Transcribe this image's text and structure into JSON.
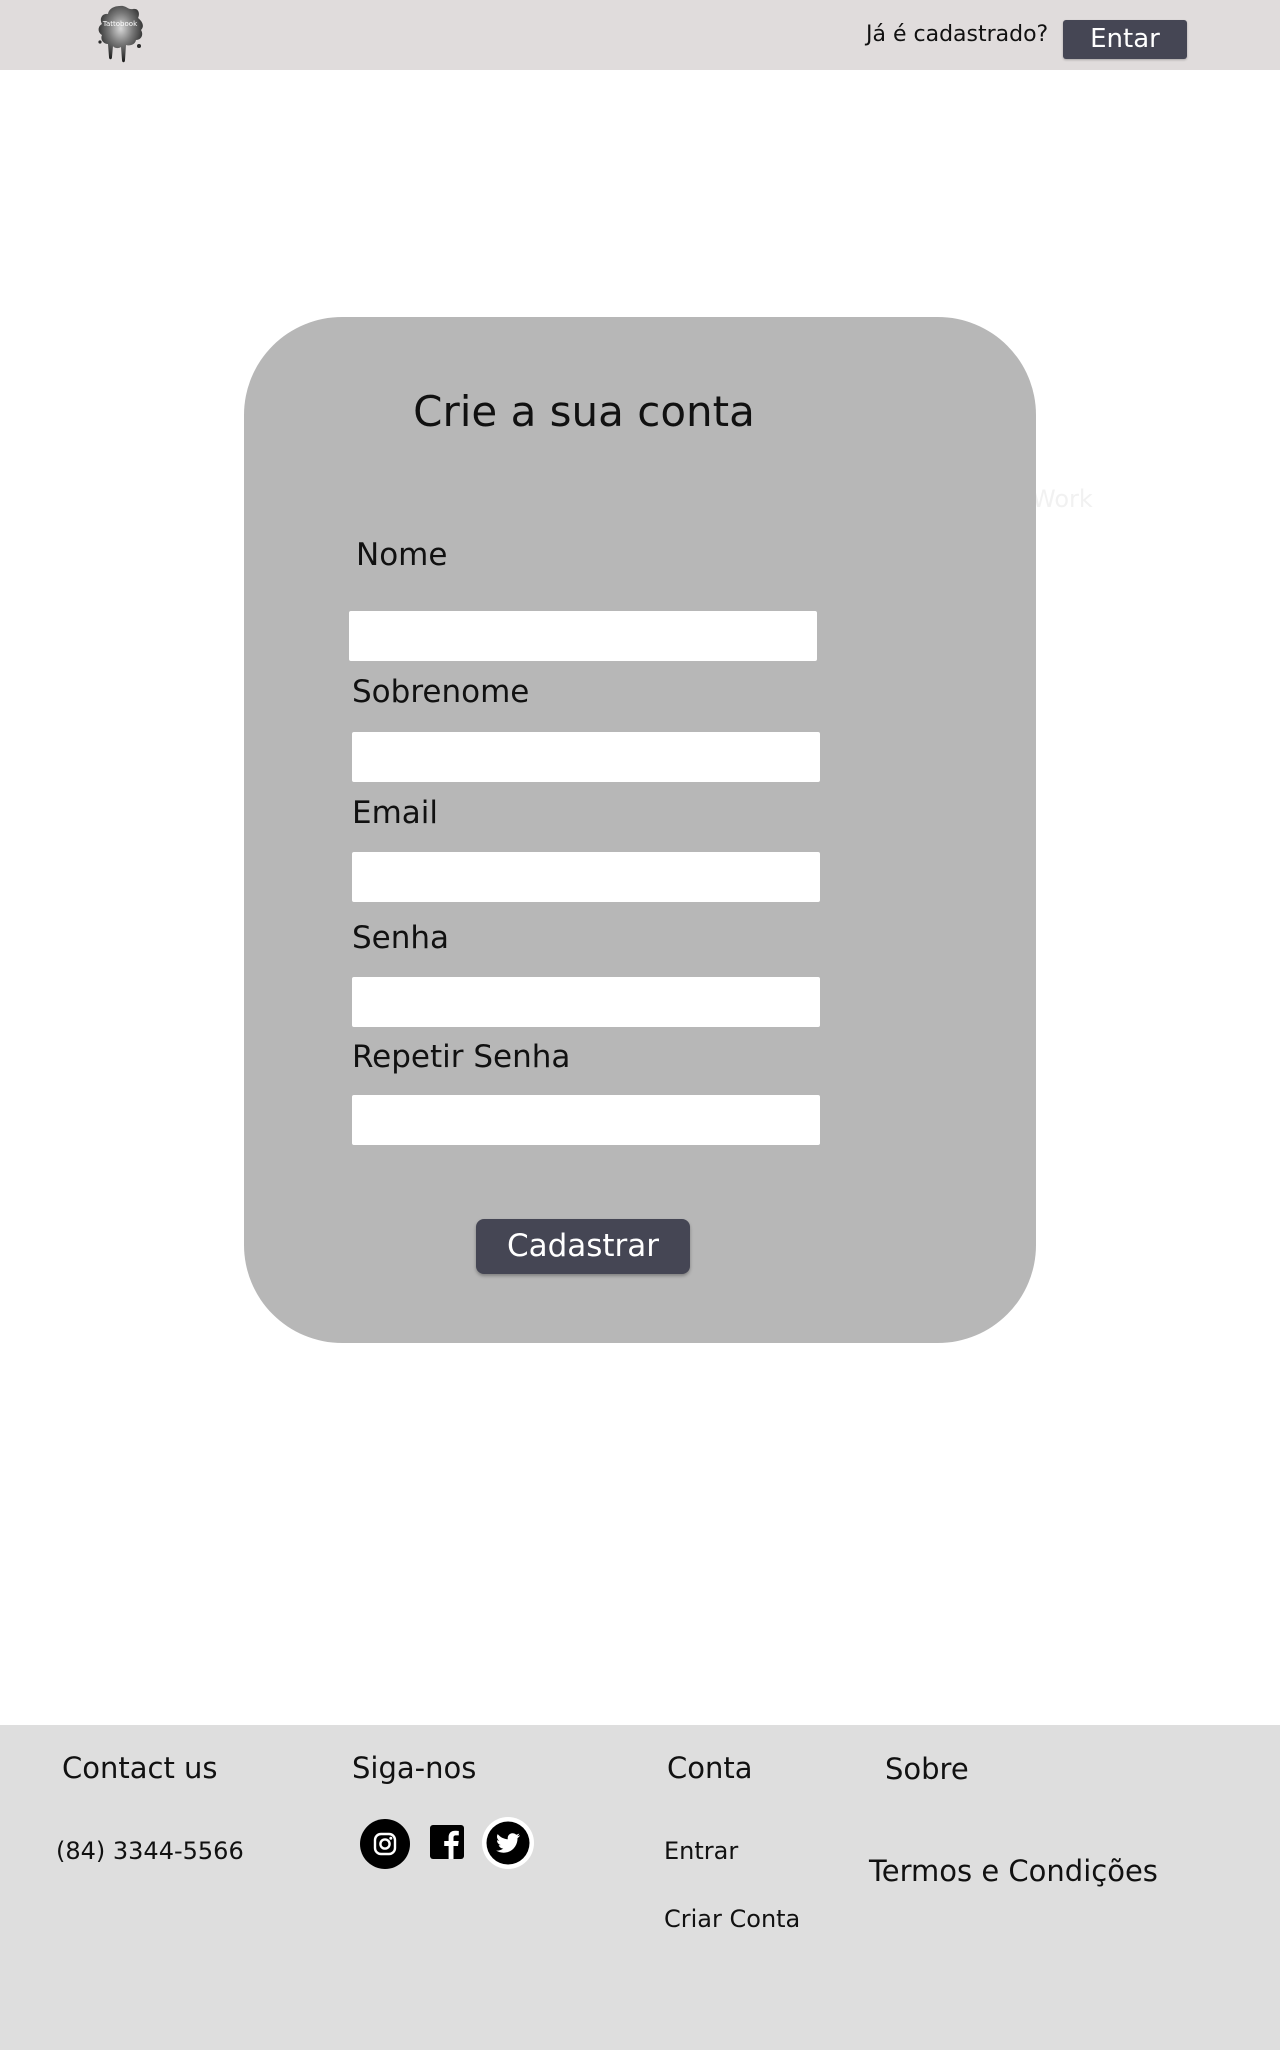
{
  "header": {
    "logo_text": "Tattobook",
    "already_registered": "Já é cadastrado?",
    "login_button": "Entar"
  },
  "background_text": "Work",
  "signup": {
    "title": "Crie a sua conta",
    "fields": [
      {
        "label": "Nome",
        "value": "",
        "placeholder": ""
      },
      {
        "label": "Sobrenome",
        "value": "",
        "placeholder": ""
      },
      {
        "label": "Email",
        "value": "",
        "placeholder": ""
      },
      {
        "label": "Senha",
        "value": "",
        "placeholder": ""
      },
      {
        "label": "Repetir Senha",
        "value": "",
        "placeholder": ""
      }
    ],
    "submit_button": "Cadastrar"
  },
  "footer": {
    "contact": {
      "heading": "Contact us",
      "phone": "(84) 3344-5566"
    },
    "follow": {
      "heading": "Siga-nos",
      "icons": [
        "instagram-icon",
        "facebook-icon",
        "twitter-icon"
      ]
    },
    "account": {
      "heading": "Conta",
      "links": [
        "Entrar",
        "Criar Conta"
      ]
    },
    "about": {
      "heading": "Sobre",
      "links": [
        "Termos e Condições"
      ]
    }
  },
  "colors": {
    "topbar_bg": "#e0dcdc",
    "button_bg": "#454654",
    "card_bg": "#b7b7b7",
    "footer_bg": "#dedede"
  }
}
